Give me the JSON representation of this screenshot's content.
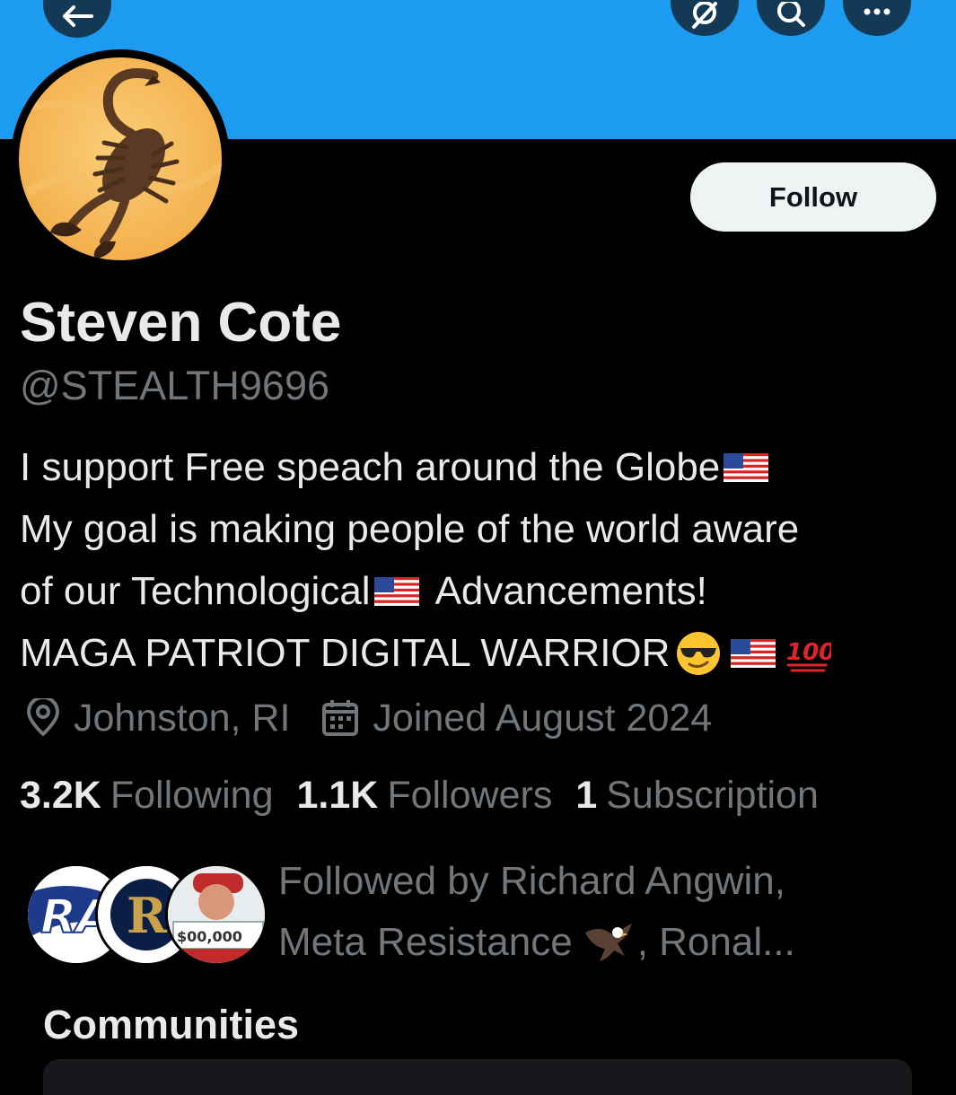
{
  "profile": {
    "follow_label": "Follow",
    "display_name": "Steven Cote",
    "handle": "@STEALTH9696",
    "bio": {
      "line1": "I support Free speach around the Globe",
      "line2": "My goal is making people of the world aware",
      "line3_a": "of our Technological",
      "line3_b": "Advancements!",
      "line4": "MAGA PATRIOT DIGITAL WARRIOR"
    },
    "location": "Johnston, RI",
    "joined": "Joined August 2024"
  },
  "stats": {
    "following_count": "3.2K",
    "following_label": "Following",
    "followers_count": "1.1K",
    "followers_label": "Followers",
    "subscription_count": "1",
    "subscription_label": "Subscription"
  },
  "followed_by": {
    "line1": "Followed by Richard Angwin,",
    "line2_a": "Meta Resistance",
    "line2_b": ", Ronal..."
  },
  "sections": {
    "communities_title": "Communities"
  },
  "icons": {
    "back": "back-arrow-icon",
    "grok": "grok-icon",
    "search": "search-icon",
    "more": "more-icon",
    "location": "location-pin-icon",
    "calendar": "calendar-icon"
  },
  "colors": {
    "banner": "#1d9bf0",
    "background": "#000000",
    "primary_text": "#e7e9ea",
    "secondary_text": "#71767b",
    "follow_button_bg": "#eff3f4"
  }
}
